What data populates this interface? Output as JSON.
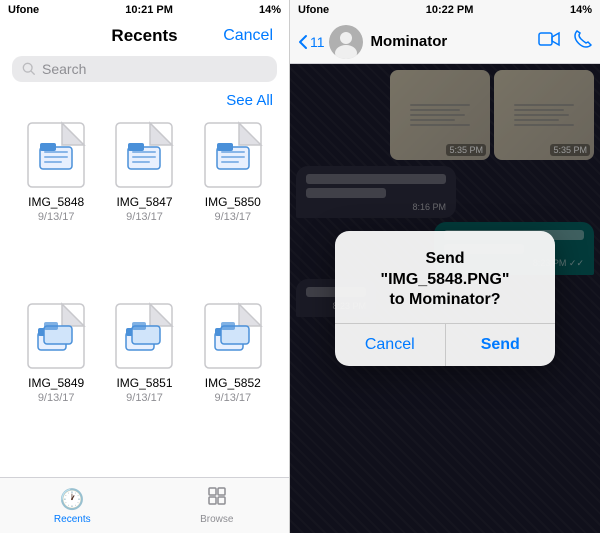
{
  "left": {
    "status_bar": {
      "carrier": "Ufone",
      "time": "10:21 PM",
      "battery": "14%"
    },
    "header": {
      "title": "Recents",
      "cancel_label": "Cancel"
    },
    "search": {
      "placeholder": "Search"
    },
    "see_all_label": "See All",
    "files": [
      {
        "name": "IMG_5848",
        "date": "9/13/17"
      },
      {
        "name": "IMG_5847",
        "date": "9/13/17"
      },
      {
        "name": "IMG_5850",
        "date": "9/13/17"
      },
      {
        "name": "IMG_5849",
        "date": "9/13/17"
      },
      {
        "name": "IMG_5851",
        "date": "9/13/17"
      },
      {
        "name": "IMG_5852",
        "date": "9/13/17"
      }
    ],
    "tabs": [
      {
        "id": "recents",
        "label": "Recents",
        "active": true
      },
      {
        "id": "browse",
        "label": "Browse",
        "active": false
      }
    ]
  },
  "right": {
    "status_bar": {
      "carrier": "Ufone",
      "time": "10:22 PM",
      "battery": "14%"
    },
    "header": {
      "back_count": "11",
      "contact_name": "Mominator"
    },
    "messages": [
      {
        "time": "5:35 PM",
        "type": "image-outgoing"
      },
      {
        "time": "5:35 PM",
        "type": "image-outgoing"
      },
      {
        "time": "8:16 PM",
        "type": "incoming"
      },
      {
        "time": "8:23 PM",
        "type": "outgoing"
      },
      {
        "time": "8:23 PM",
        "type": "incoming"
      }
    ],
    "dialog": {
      "title": "Send",
      "filename": "\"IMG_5848.PNG\"",
      "to_label": "to Mominator?",
      "cancel_label": "Cancel",
      "send_label": "Send"
    }
  }
}
